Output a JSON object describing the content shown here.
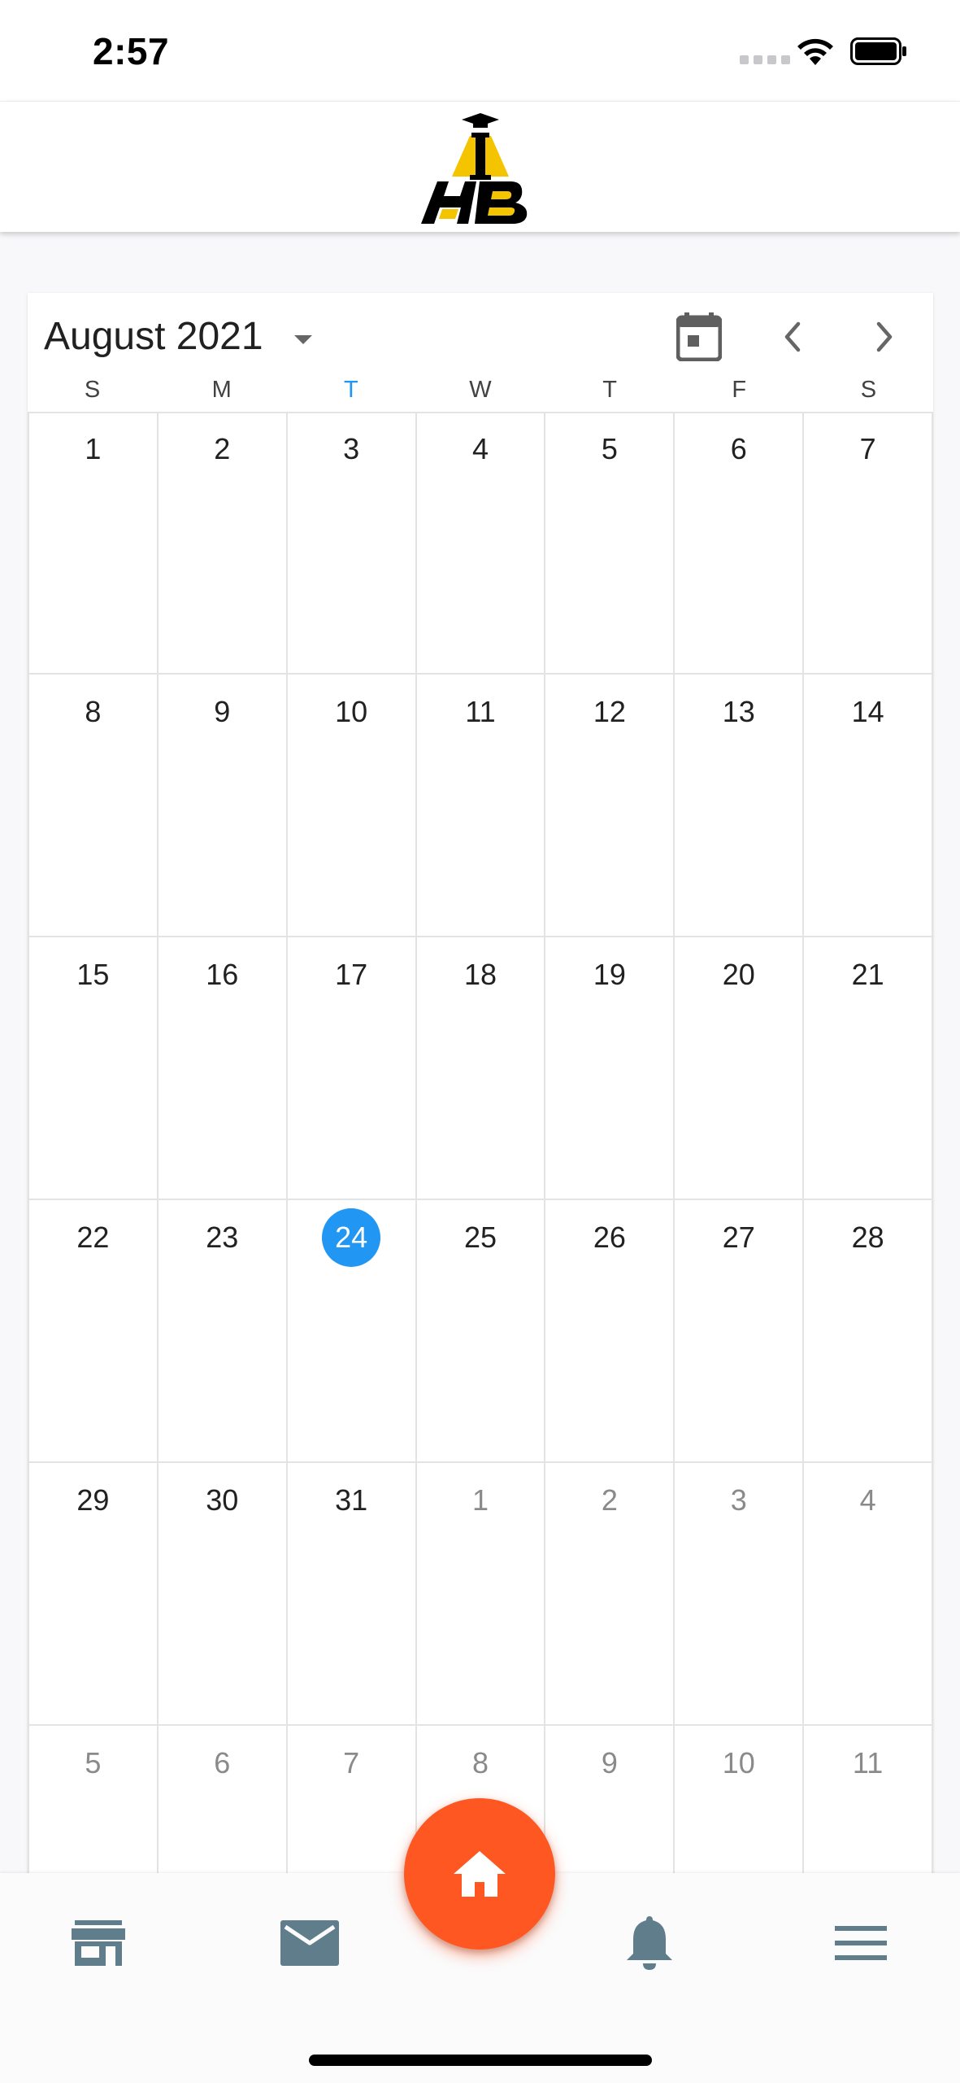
{
  "status_bar": {
    "time": "2:57"
  },
  "header": {
    "logo_icon": "ihb-logo"
  },
  "calendar": {
    "month_label": "August 2021",
    "weekdays": [
      "S",
      "M",
      "T",
      "W",
      "T",
      "F",
      "S"
    ],
    "today_column": 2,
    "weeks": [
      [
        {
          "d": "1",
          "o": false
        },
        {
          "d": "2",
          "o": false
        },
        {
          "d": "3",
          "o": false
        },
        {
          "d": "4",
          "o": false
        },
        {
          "d": "5",
          "o": false
        },
        {
          "d": "6",
          "o": false
        },
        {
          "d": "7",
          "o": false
        }
      ],
      [
        {
          "d": "8",
          "o": false
        },
        {
          "d": "9",
          "o": false
        },
        {
          "d": "10",
          "o": false
        },
        {
          "d": "11",
          "o": false
        },
        {
          "d": "12",
          "o": false
        },
        {
          "d": "13",
          "o": false
        },
        {
          "d": "14",
          "o": false
        }
      ],
      [
        {
          "d": "15",
          "o": false
        },
        {
          "d": "16",
          "o": false
        },
        {
          "d": "17",
          "o": false
        },
        {
          "d": "18",
          "o": false
        },
        {
          "d": "19",
          "o": false
        },
        {
          "d": "20",
          "o": false
        },
        {
          "d": "21",
          "o": false
        }
      ],
      [
        {
          "d": "22",
          "o": false
        },
        {
          "d": "23",
          "o": false
        },
        {
          "d": "24",
          "o": false,
          "today": true
        },
        {
          "d": "25",
          "o": false
        },
        {
          "d": "26",
          "o": false
        },
        {
          "d": "27",
          "o": false
        },
        {
          "d": "28",
          "o": false
        }
      ],
      [
        {
          "d": "29",
          "o": false
        },
        {
          "d": "30",
          "o": false
        },
        {
          "d": "31",
          "o": false
        },
        {
          "d": "1",
          "o": true
        },
        {
          "d": "2",
          "o": true
        },
        {
          "d": "3",
          "o": true
        },
        {
          "d": "4",
          "o": true
        }
      ],
      [
        {
          "d": "5",
          "o": true
        },
        {
          "d": "6",
          "o": true
        },
        {
          "d": "7",
          "o": true
        },
        {
          "d": "8",
          "o": true
        },
        {
          "d": "9",
          "o": true
        },
        {
          "d": "10",
          "o": true
        },
        {
          "d": "11",
          "o": true
        }
      ]
    ]
  },
  "nav": {
    "items": [
      "store-icon",
      "mail-icon",
      "home-icon",
      "bell-icon",
      "menu-icon"
    ]
  },
  "colors": {
    "accent": "#2196f3",
    "fab": "#ff5722",
    "nav_icon": "#607d8b"
  }
}
